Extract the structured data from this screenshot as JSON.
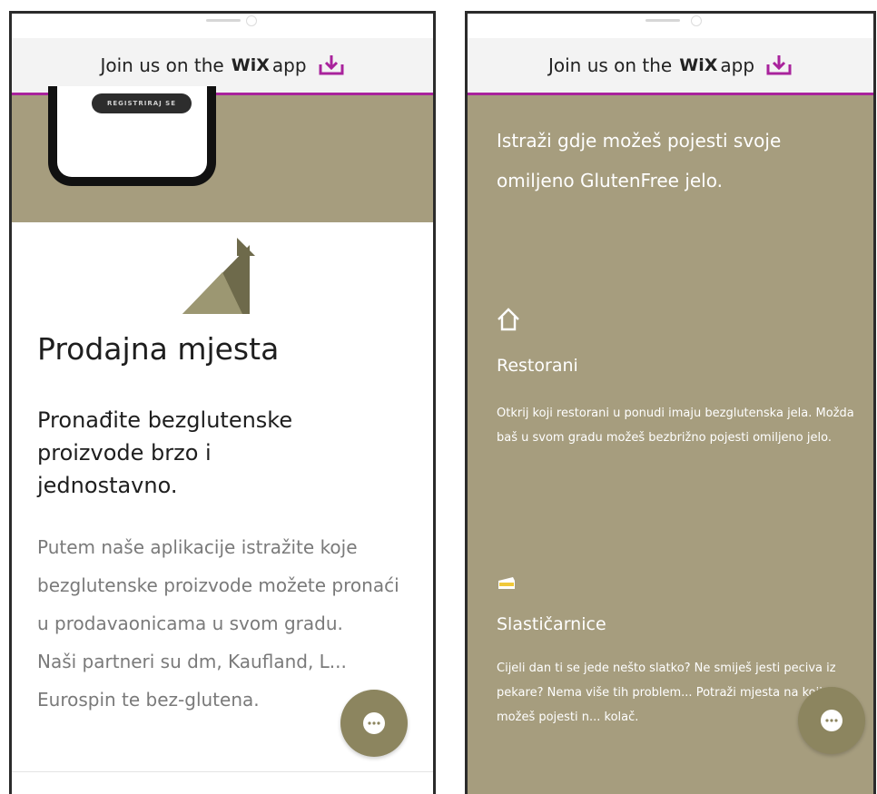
{
  "banner": {
    "text": "Join us on the",
    "brand": "WiX",
    "suffix": "app",
    "icon": "download-icon",
    "accent_color": "#a9239c"
  },
  "left": {
    "hero_button_label": "REGISTRIRAJ SE",
    "title": "Prodajna mjesta",
    "subtitle": "Pronađite bezglutenske proizvode brzo i jednostavno.",
    "body_1": "Putem naše aplikacije istražite koje bezglutenske proizvode možete pronaći u prodavaonicama u svom gradu.",
    "body_2": "Naši partneri su dm, Kaufland, L... Eurospin te bez-glutena."
  },
  "right": {
    "intro": "Istraži gdje možeš pojesti svoje omiljeno GlutenFree jelo.",
    "restorani": {
      "title": "Restorani",
      "description": "Otkrij koji restorani u ponudi imaju bezglutenska jela. Možda baš u svom gradu možeš bezbrižno pojesti omiljeno jelo.",
      "icon": "house-icon"
    },
    "slasticarnice": {
      "title": "Slastičarnice",
      "description": "Cijeli dan ti se jede nešto slatko? Ne smiješ jesti peciva iz pekare? Nema više tih problem... Potraži mjesta na kojima možeš pojesti n... kolač.",
      "icon": "cake-icon"
    }
  },
  "colors": {
    "olive": "#a69d7e",
    "chat_button": "#8c855f"
  }
}
